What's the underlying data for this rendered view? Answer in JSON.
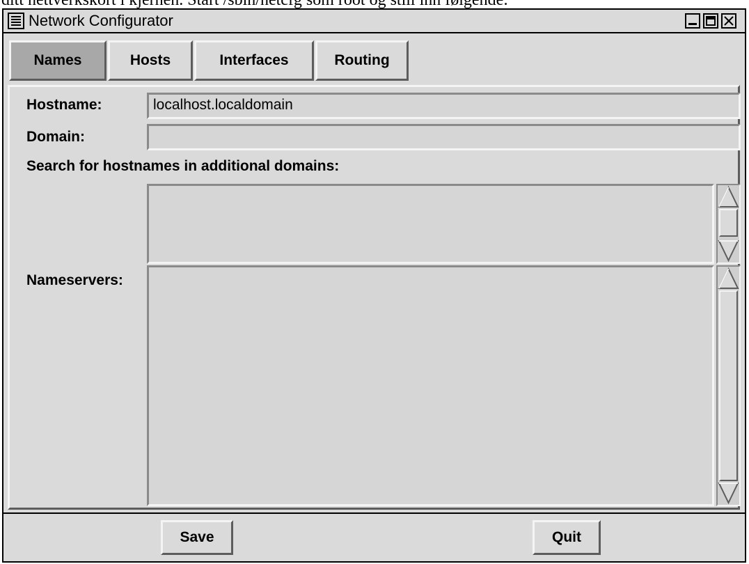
{
  "background_text": "ditt nettverkskort i kjernen. Start /sbin/netcfg som root og still inn følgende:",
  "window": {
    "title": "Network Configurator",
    "menu_icon": "window-menu-icon",
    "controls": [
      "minimize-icon",
      "maximize-icon",
      "close-icon"
    ]
  },
  "tabs": [
    {
      "label": "Names",
      "active": true
    },
    {
      "label": "Hosts",
      "active": false
    },
    {
      "label": "Interfaces",
      "active": false
    },
    {
      "label": "Routing",
      "active": false
    }
  ],
  "names_panel": {
    "hostname_label": "Hostname:",
    "hostname_value": "localhost.localdomain",
    "domain_label": "Domain:",
    "domain_value": "",
    "search_label": "Search for hostnames in additional domains:",
    "nameservers_label": "Nameservers:"
  },
  "buttons": {
    "save_label": "Save",
    "quit_label": "Quit"
  }
}
